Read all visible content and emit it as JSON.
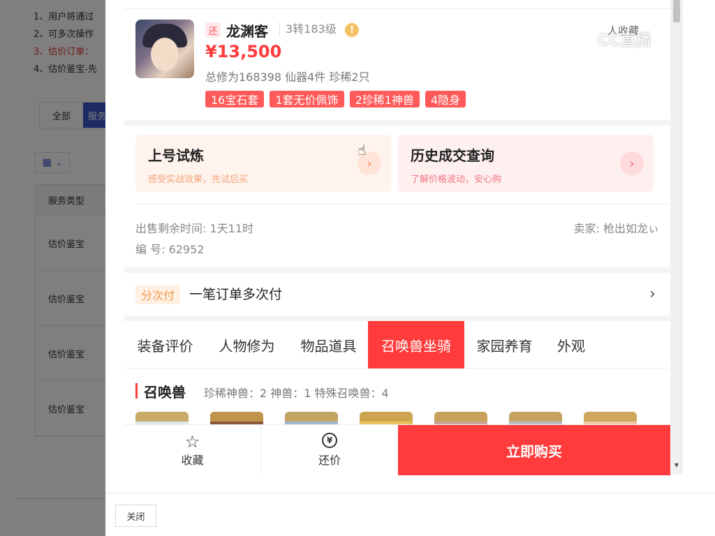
{
  "background": {
    "notes": [
      {
        "text": "1、用户将通过",
        "red": false
      },
      {
        "text": "2、可多次操作",
        "red": false
      },
      {
        "text": "3、估价订单：",
        "red": true
      },
      {
        "text": "4、估价鉴宝-先",
        "red": false
      }
    ],
    "tabs": [
      "全部",
      "服务"
    ],
    "table_header": "服务类型",
    "table_rows": [
      "估价鉴宝",
      "估价鉴宝",
      "估价鉴宝",
      "估价鉴宝"
    ]
  },
  "product": {
    "tag": "还",
    "name": "龙渊客",
    "level": "3转183级",
    "warn": "!",
    "fav_count": "人收藏",
    "price": "¥13,500",
    "stats": "总修为168398  仙器4件  珍稀2只",
    "tags": [
      "16宝石套",
      "1套无价佩饰",
      "2珍稀1神兽",
      "4隐身"
    ]
  },
  "cards": {
    "trial": {
      "title": "上号试炼",
      "sub": "感受实战效果，先试后买",
      "arrow": "›"
    },
    "history": {
      "title": "历史成交查询",
      "sub": "了解价格波动，安心购",
      "arrow": "›"
    }
  },
  "info": {
    "remaining": "出售剩余时间: 1天11时",
    "serial": "编 号: 62952",
    "seller": "卖家: 枪出如龙ぃ"
  },
  "payment": {
    "tag": "分次付",
    "text": "一笔订单多次付",
    "arrow": "›"
  },
  "tabs": [
    {
      "label": "装备评价",
      "active": false
    },
    {
      "label": "人物修为",
      "active": false
    },
    {
      "label": "物品道具",
      "active": false
    },
    {
      "label": "召唤兽坐骑",
      "active": true
    },
    {
      "label": "家园养育",
      "active": false
    },
    {
      "label": "外观",
      "active": false
    }
  ],
  "section": {
    "title": "召唤兽",
    "stats": "珍稀神兽：2   神兽：1   特殊召唤兽：4"
  },
  "bottom": {
    "favorite": "收藏",
    "bargain": "还价",
    "buy": "立即购买"
  },
  "footer": {
    "close": "关闭"
  },
  "watermark": "CC直播",
  "colors": {
    "accent": "#ff3b3b",
    "tag_bg": "#ff5a5a",
    "pay_tag": "#f39a4e"
  }
}
